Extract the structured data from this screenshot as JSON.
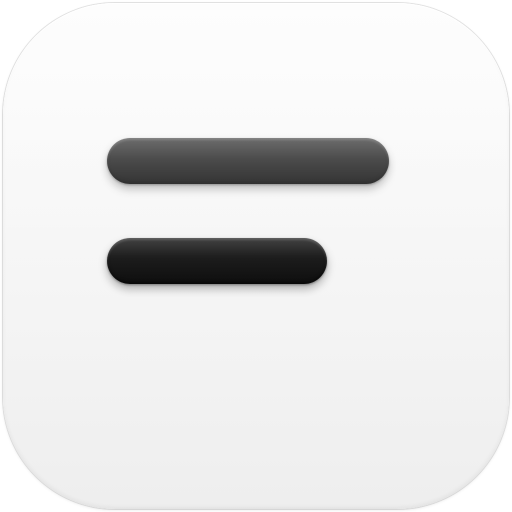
{
  "app_icon": {
    "icon_name": "text-lines-icon",
    "background_color": "#f6f6f6",
    "glyph_color": "#141414",
    "glyph_lines": [
      "long",
      "short"
    ]
  }
}
